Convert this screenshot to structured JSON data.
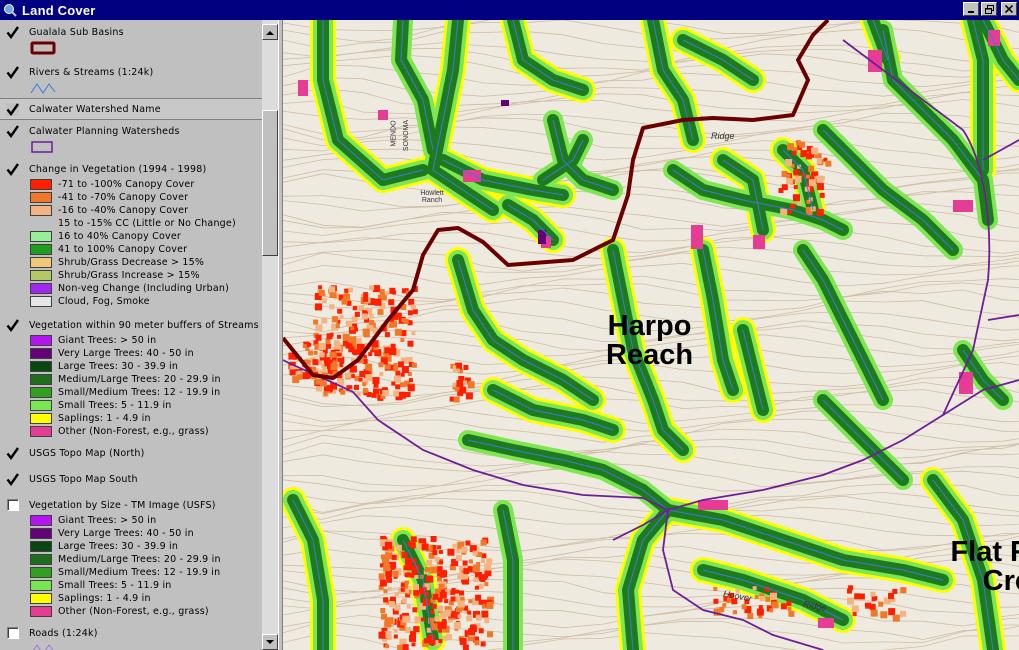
{
  "window": {
    "title": "Land Cover"
  },
  "toc": {
    "themes": [
      {
        "name": "Gualala Sub Basins",
        "checked": true,
        "symbol": "polygon-outline",
        "color": "#6b0000"
      },
      {
        "name": "Rivers & Streams (1:24k)",
        "checked": true,
        "symbol": "line",
        "color": "#3c78dc"
      },
      {
        "name": "Calwater Watershed Name",
        "checked": true,
        "symbol": "none"
      },
      {
        "name": "Calwater Planning Watersheds",
        "checked": true,
        "symbol": "polygon-outline",
        "color": "#6e1e96"
      },
      {
        "name": "Change in Vegetation (1994 - 1998)",
        "checked": true,
        "symbol": "classes",
        "classes": [
          {
            "label": "-71 to -100% Canopy Cover",
            "color": "#ff1e00"
          },
          {
            "label": "-41 to -70% Canopy Cover",
            "color": "#f07828"
          },
          {
            "label": "-16 to -40% Canopy Cover",
            "color": "#f4b482"
          },
          {
            "label": "15 to -15% CC (Little or No Change)",
            "color": null
          },
          {
            "label": "16 to 40% Canopy Cover",
            "color": "#96f096"
          },
          {
            "label": "41 to 100% Canopy Cover",
            "color": "#1ea01e"
          },
          {
            "label": "Shrub/Grass Decrease > 15%",
            "color": "#f0c878"
          },
          {
            "label": "Shrub/Grass Increase > 15%",
            "color": "#b4c864"
          },
          {
            "label": "Non-veg Change (Including Urban)",
            "color": "#a028f0"
          },
          {
            "label": "Cloud, Fog, Smoke",
            "color": "#e6e6e6"
          }
        ]
      },
      {
        "name": "Vegetation within 90 meter buffers of Streams",
        "checked": true,
        "symbol": "classes",
        "classes": [
          {
            "label": "Giant Trees: > 50 in",
            "color": "#b414f0"
          },
          {
            "label": "Very Large Trees: 40 - 50 in",
            "color": "#640078"
          },
          {
            "label": "Large Trees: 30 - 39.9 in",
            "color": "#0a4614"
          },
          {
            "label": "Medium/Large Trees: 20 - 29.9 in",
            "color": "#1e6e1e"
          },
          {
            "label": "Small/Medium Trees: 12 - 19.9 in",
            "color": "#32a01e"
          },
          {
            "label": "Small Trees: 5 - 11.9 in",
            "color": "#78e650"
          },
          {
            "label": "Saplings: 1 - 4.9 in",
            "color": "#ffff00"
          },
          {
            "label": "Other (Non-Forest, e.g., grass)",
            "color": "#e63c96"
          }
        ]
      },
      {
        "name": "USGS Topo Map (North)",
        "checked": true,
        "symbol": "none"
      },
      {
        "name": "USGS Topo Map South",
        "checked": true,
        "symbol": "none"
      },
      {
        "name": "Vegetation by Size - TM Image (USFS)",
        "checked": false,
        "symbol": "classes",
        "classes": [
          {
            "label": "Giant Trees: > 50 in",
            "color": "#b414f0"
          },
          {
            "label": "Very Large Trees: 40 - 50 in",
            "color": "#640078"
          },
          {
            "label": "Large Trees: 30 - 39.9 in",
            "color": "#0a4614"
          },
          {
            "label": "Medium/Large Trees: 20 - 29.9 in",
            "color": "#1e6e1e"
          },
          {
            "label": "Small/Medium Trees: 12 - 19.9 in",
            "color": "#32a01e"
          },
          {
            "label": "Small Trees: 5 - 11.9 in",
            "color": "#78e650"
          },
          {
            "label": "Saplings: 1 - 4.9 in",
            "color": "#ffff00"
          },
          {
            "label": "Other (Non-Forest, e.g., grass)",
            "color": "#e63c96"
          }
        ]
      },
      {
        "name": "Roads (1:24k)",
        "checked": false,
        "symbol": "line",
        "color": "#a078dc"
      }
    ]
  },
  "map": {
    "labels": {
      "harpo": [
        "Harpo",
        "Reach"
      ],
      "flat": [
        "Flat R",
        "Cre"
      ]
    },
    "small_labels": [
      "Ridge",
      "Hoover",
      "Ridge",
      "MENDO",
      "SONOMA",
      "Howlett Ranch"
    ],
    "colors": {
      "basin_boundary": "#6b0000",
      "watershed_boundary": "#6e1e96",
      "stream": "#3c78dc",
      "topo_background": "#eeeae0",
      "contour": "#c9b8a0"
    }
  }
}
